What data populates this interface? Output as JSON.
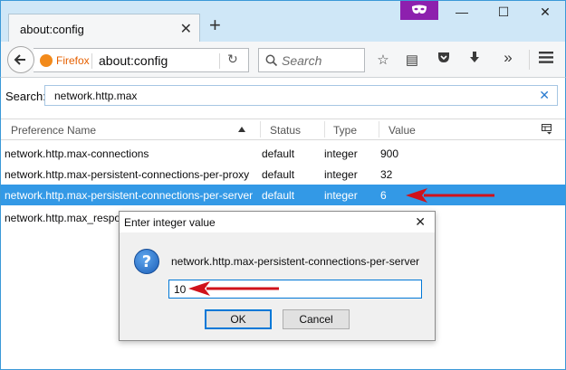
{
  "tab": {
    "title": "about:config",
    "close": "✕"
  },
  "window": {
    "new_tab": "+",
    "minimize": "—",
    "maximize": "☐",
    "close": "✕"
  },
  "navbar": {
    "identity_label": "Firefox",
    "url": "about:config",
    "reload": "↻",
    "search_placeholder": "Search",
    "icons": [
      "star-icon",
      "reading-list-icon",
      "pocket-icon",
      "download-icon",
      "overflow-icon",
      "menu-icon"
    ]
  },
  "filter": {
    "label": "Search:",
    "value": "network.http.max",
    "clear": "✕"
  },
  "table": {
    "headers": {
      "name": "Preference Name",
      "status": "Status",
      "type": "Type",
      "value": "Value"
    },
    "rows": [
      {
        "name": "network.http.max-connections",
        "status": "default",
        "type": "integer",
        "value": "900"
      },
      {
        "name": "network.http.max-persistent-connections-per-proxy",
        "status": "default",
        "type": "integer",
        "value": "32"
      },
      {
        "name": "network.http.max-persistent-connections-per-server",
        "status": "default",
        "type": "integer",
        "value": "6",
        "selected": true
      },
      {
        "name": "network.http.max_respo",
        "status": "",
        "type": "",
        "value": ""
      }
    ]
  },
  "dialog": {
    "title": "Enter integer value",
    "close": "✕",
    "icon": "?",
    "message": "network.http.max-persistent-connections-per-server",
    "input_value": "10",
    "ok_label": "OK",
    "cancel_label": "Cancel"
  },
  "colors": {
    "accent": "#3399e6",
    "annotation_arrow": "#d0121b",
    "private_badge": "#8d20ae"
  }
}
